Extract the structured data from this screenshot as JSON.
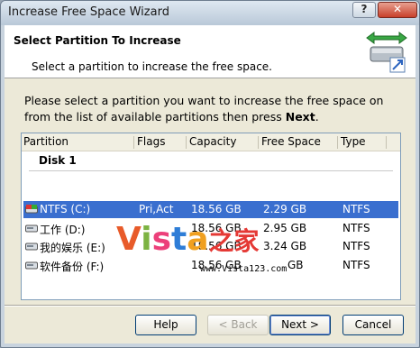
{
  "window": {
    "title": "Increase Free Space Wizard",
    "help_glyph": "?",
    "close_glyph": "✕"
  },
  "header": {
    "title": "Select Partition To Increase",
    "subtitle": "Select a partition to increase the free space."
  },
  "instructions": {
    "text_before": "Please select a partition you want to increase the free space on from the list of available partitions then press ",
    "bold_word": "Next",
    "text_after": "."
  },
  "list": {
    "columns": [
      "Partition",
      "Flags",
      "Capacity",
      "Free Space",
      "Type"
    ],
    "group_label": "Disk 1",
    "rows": [
      {
        "partition": "NTFS (C:)",
        "flags": "Pri,Act",
        "capacity": "18.56 GB",
        "free": "2.29 GB",
        "type": "NTFS",
        "selected": true
      },
      {
        "partition": "工作 (D:)",
        "flags": "",
        "capacity": "18.56 GB",
        "free": "2.95 GB",
        "type": "NTFS",
        "selected": false
      },
      {
        "partition": "我的娱乐 (E:)",
        "flags": "",
        "capacity": "18.56 GB",
        "free": "3.24 GB",
        "type": "NTFS",
        "selected": false
      },
      {
        "partition": "软件备份 (F:)",
        "flags": "",
        "capacity": "18.56 GB",
        "free": "GB",
        "type": "NTFS",
        "selected": false
      }
    ]
  },
  "watermark": {
    "logo": "Vista之家",
    "url": "www.Vista123.com"
  },
  "buttons": {
    "help": "Help",
    "back": "< Back",
    "next": "Next >",
    "cancel": "Cancel"
  }
}
